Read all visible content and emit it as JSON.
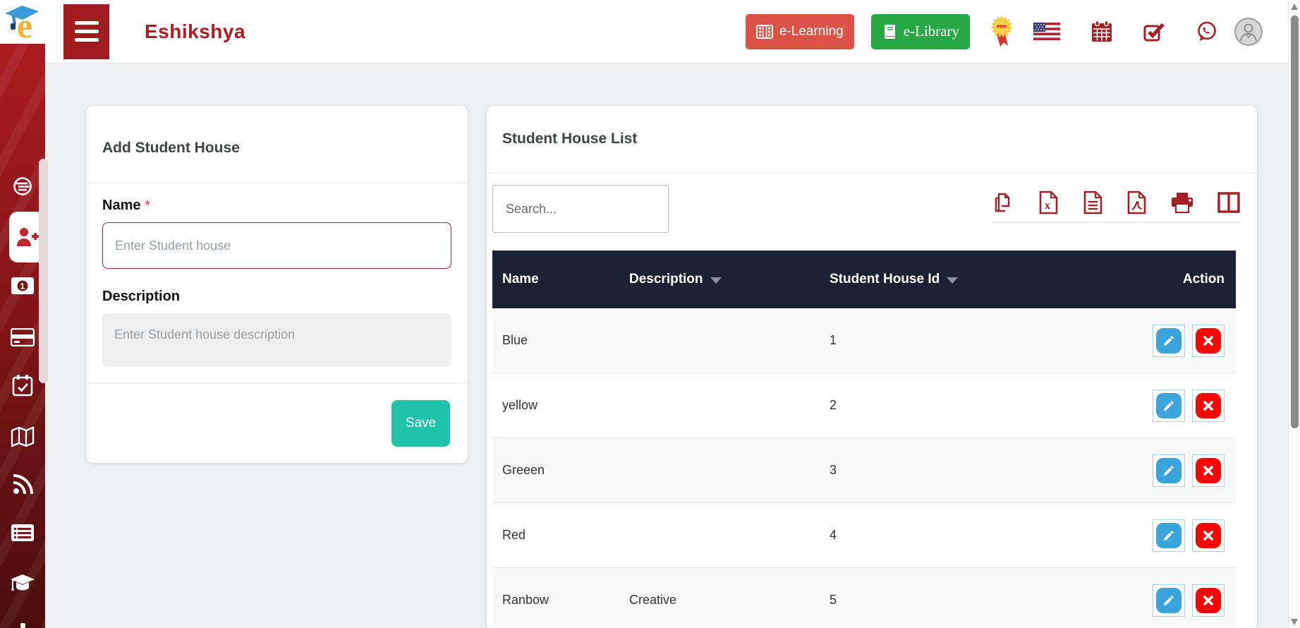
{
  "header": {
    "brand": "Eshikshya",
    "e_learning_label": "e-Learning",
    "e_library_label": "e-Library",
    "icons": [
      "film-icon",
      "book-icon",
      "certificate-badge-icon",
      "us-flag-icon",
      "calendar-icon",
      "task-check-icon",
      "whatsapp-icon",
      "user-avatar"
    ]
  },
  "sidebar": {
    "items": [
      {
        "icon": "dashboard-coin-icon",
        "active": false
      },
      {
        "icon": "student-add-icon",
        "active": true
      },
      {
        "icon": "money-icon",
        "active": false
      },
      {
        "icon": "credit-card-icon",
        "active": false
      },
      {
        "icon": "calendar-check-icon",
        "active": false
      },
      {
        "icon": "map-icon",
        "active": false
      },
      {
        "icon": "rss-icon",
        "active": false
      },
      {
        "icon": "list-icon",
        "active": false
      },
      {
        "icon": "graduation-cap-icon",
        "active": false
      }
    ]
  },
  "form_card": {
    "title": "Add Student House",
    "name_label": "Name",
    "required_marker": "*",
    "name_placeholder": "Enter Student house",
    "description_label": "Description",
    "description_placeholder": "Enter Student house description",
    "save_label": "Save"
  },
  "list_card": {
    "title": "Student House List",
    "search_placeholder": "Search...",
    "export_tools": [
      "copy-icon",
      "excel-export-icon",
      "csv-export-icon",
      "pdf-export-icon",
      "print-icon",
      "column-visibility-icon"
    ],
    "table": {
      "columns": [
        "Name",
        "Description",
        "Student House Id",
        "Action"
      ],
      "sortable_columns": [
        "Description",
        "Student House Id"
      ],
      "rows": [
        {
          "name": "Blue",
          "description": "",
          "id": "1"
        },
        {
          "name": "yellow",
          "description": "",
          "id": "2"
        },
        {
          "name": "Greeen",
          "description": "",
          "id": "3"
        },
        {
          "name": "Red",
          "description": "",
          "id": "4"
        },
        {
          "name": "Ranbow",
          "description": "Creative",
          "id": "5"
        }
      ]
    }
  },
  "colors": {
    "sidebar_red": "#8c1518",
    "brand_red": "#b11b20",
    "e_learning_red": "#dc5246",
    "e_library_green": "#28a745",
    "table_header_navy": "#1a2233",
    "save_teal": "#20c3a7",
    "edit_blue": "#3ba4da",
    "delete_red": "#fa0507",
    "export_icon_red": "#a42024"
  }
}
